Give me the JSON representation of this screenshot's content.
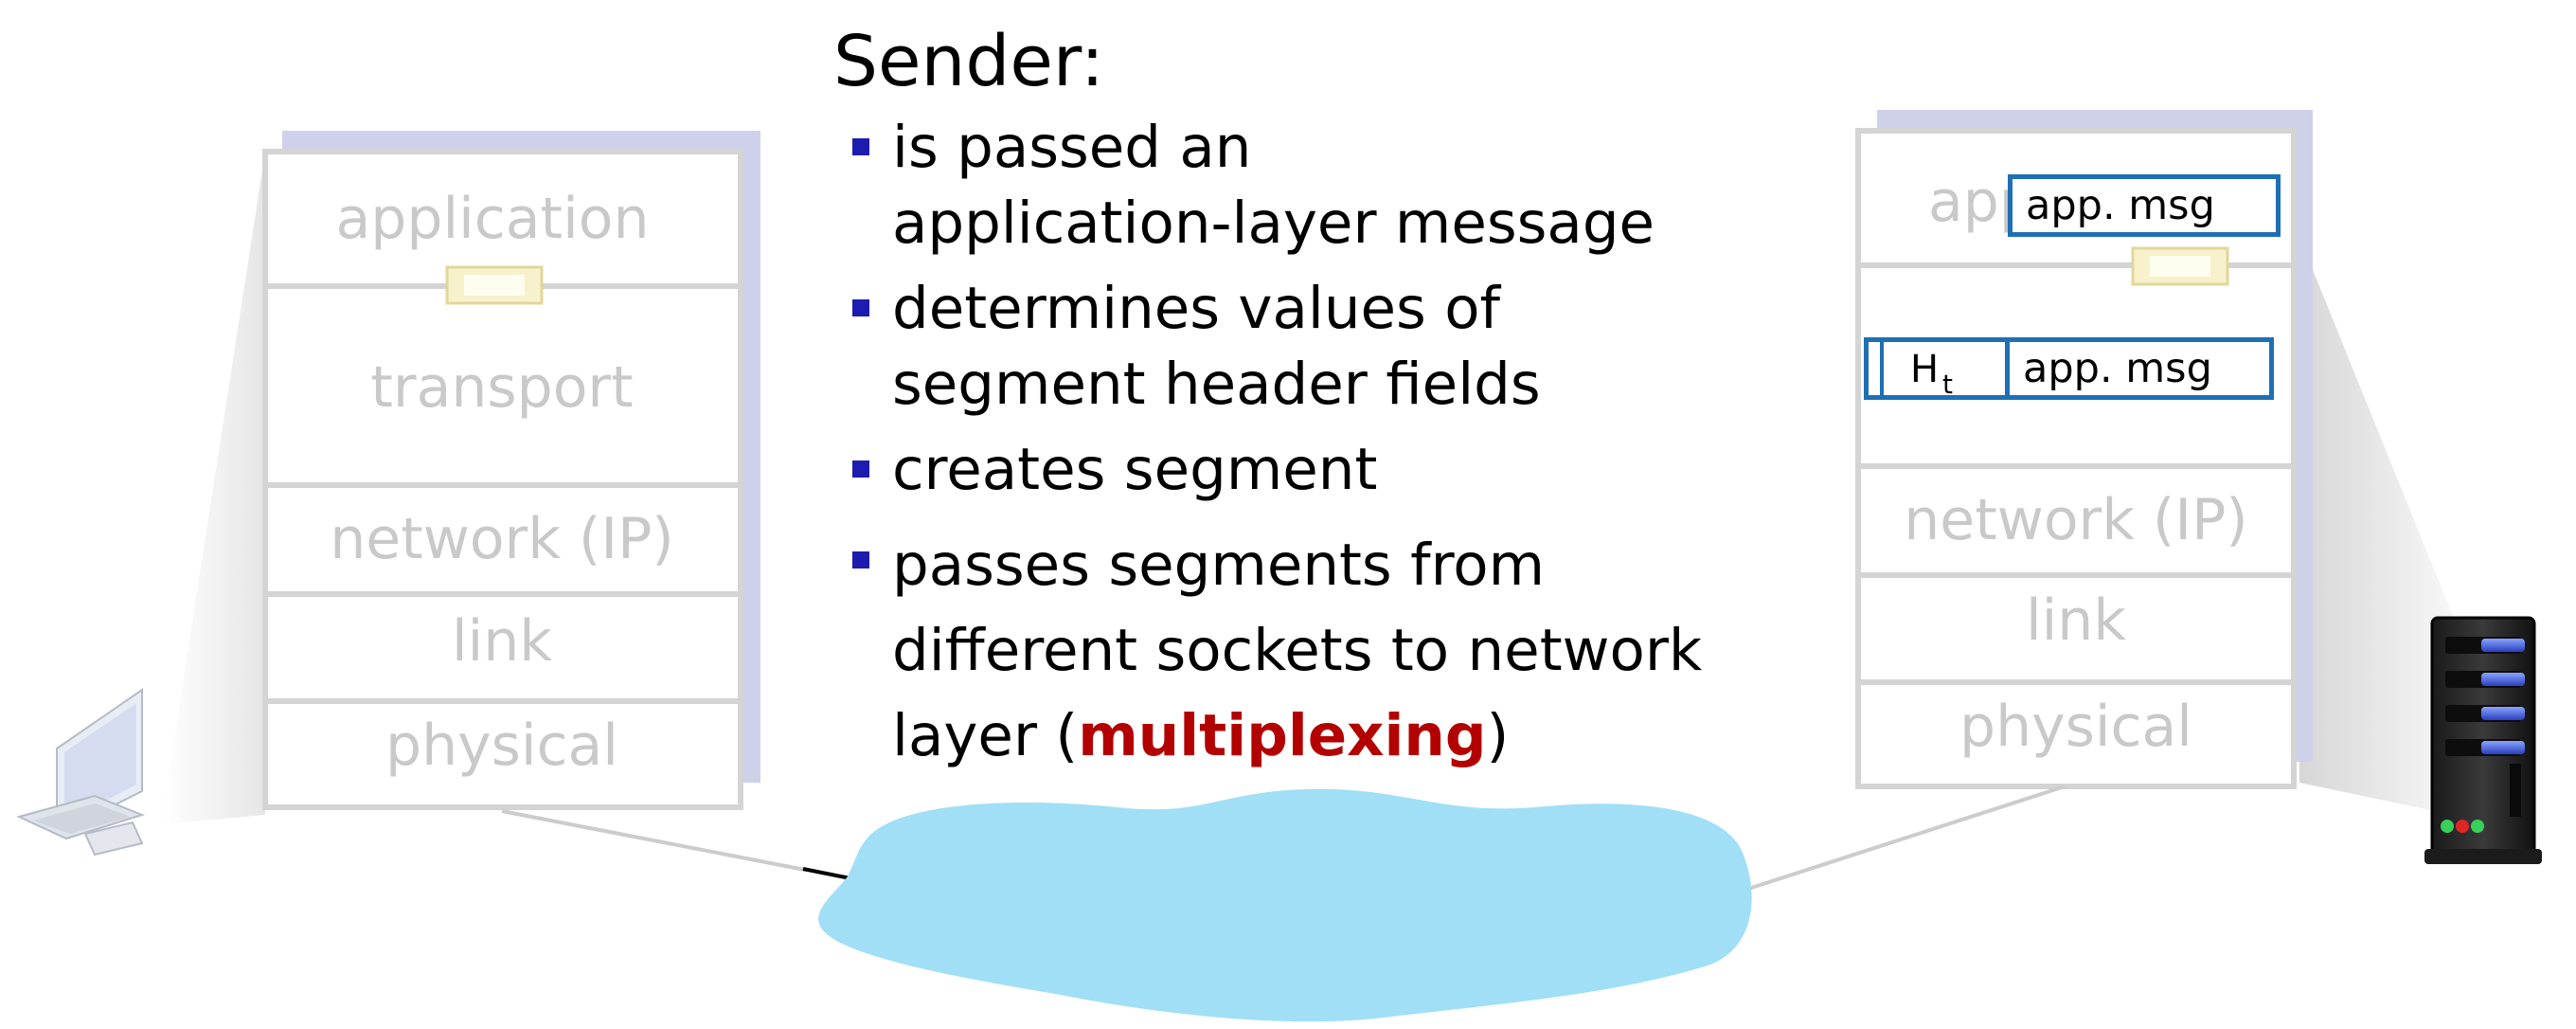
{
  "sender_panel": {
    "title": "Sender:",
    "bullets": {
      "b1_line1": "is passed an",
      "b1_line2": "application-layer message",
      "b2_line1": "determines values of",
      "b2_line2": "segment header fields",
      "b3": "creates segment",
      "b4_line1": "passes segments from",
      "b4_line2": "different sockets to network",
      "b4_line3_pre": "layer (",
      "b4_emph": "multiplexing",
      "b4_line3_post": ")"
    }
  },
  "left_stack": {
    "application": "application",
    "transport": "transport",
    "network": "network (IP)",
    "link": "link",
    "physical": "physical"
  },
  "right_stack": {
    "application_partial": "app",
    "network": "network (IP)",
    "link": "link",
    "physical": "physical"
  },
  "messages": {
    "app_msg_top": "app. msg",
    "header_label": "H",
    "header_sub": "t",
    "app_msg_segment": "app. msg"
  },
  "colors": {
    "layer_text": "#c9c9c9",
    "stack_border": "#d4d4d4",
    "stack_shadow": "#cfd0ea",
    "bullet": "#1c1cb0",
    "emphasis": "#b30000",
    "message_border": "#1f6fb4",
    "cloud": "#a0dff6"
  },
  "icons": {
    "left_host": "desktop-computer-icon",
    "right_host": "server-tower-icon",
    "network": "network-cloud-icon",
    "socket": "socket-icon"
  }
}
